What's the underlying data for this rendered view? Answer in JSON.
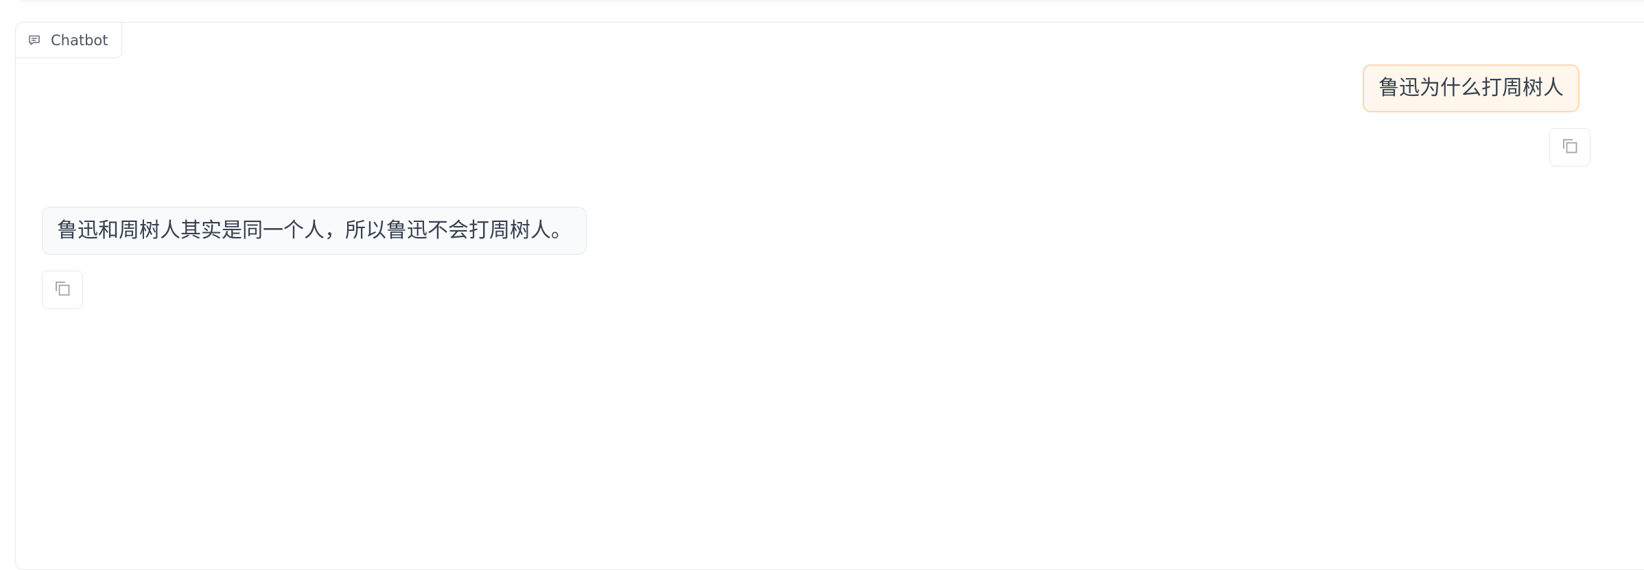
{
  "panel": {
    "label": "Chatbot",
    "icon": "chat-icon"
  },
  "messages": [
    {
      "role": "user",
      "text": "鲁迅为什么打周树人",
      "copy_icon": "copy-icon"
    },
    {
      "role": "bot",
      "text": "鲁迅和周树人其实是同一个人，所以鲁迅不会打周树人。",
      "copy_icon": "copy-icon"
    }
  ],
  "colors": {
    "user_bubble_bg": "#fff7ed",
    "user_bubble_border": "#fed7aa",
    "bot_bubble_bg": "#f9fafb",
    "border": "#e5e7eb",
    "text": "#374151"
  }
}
